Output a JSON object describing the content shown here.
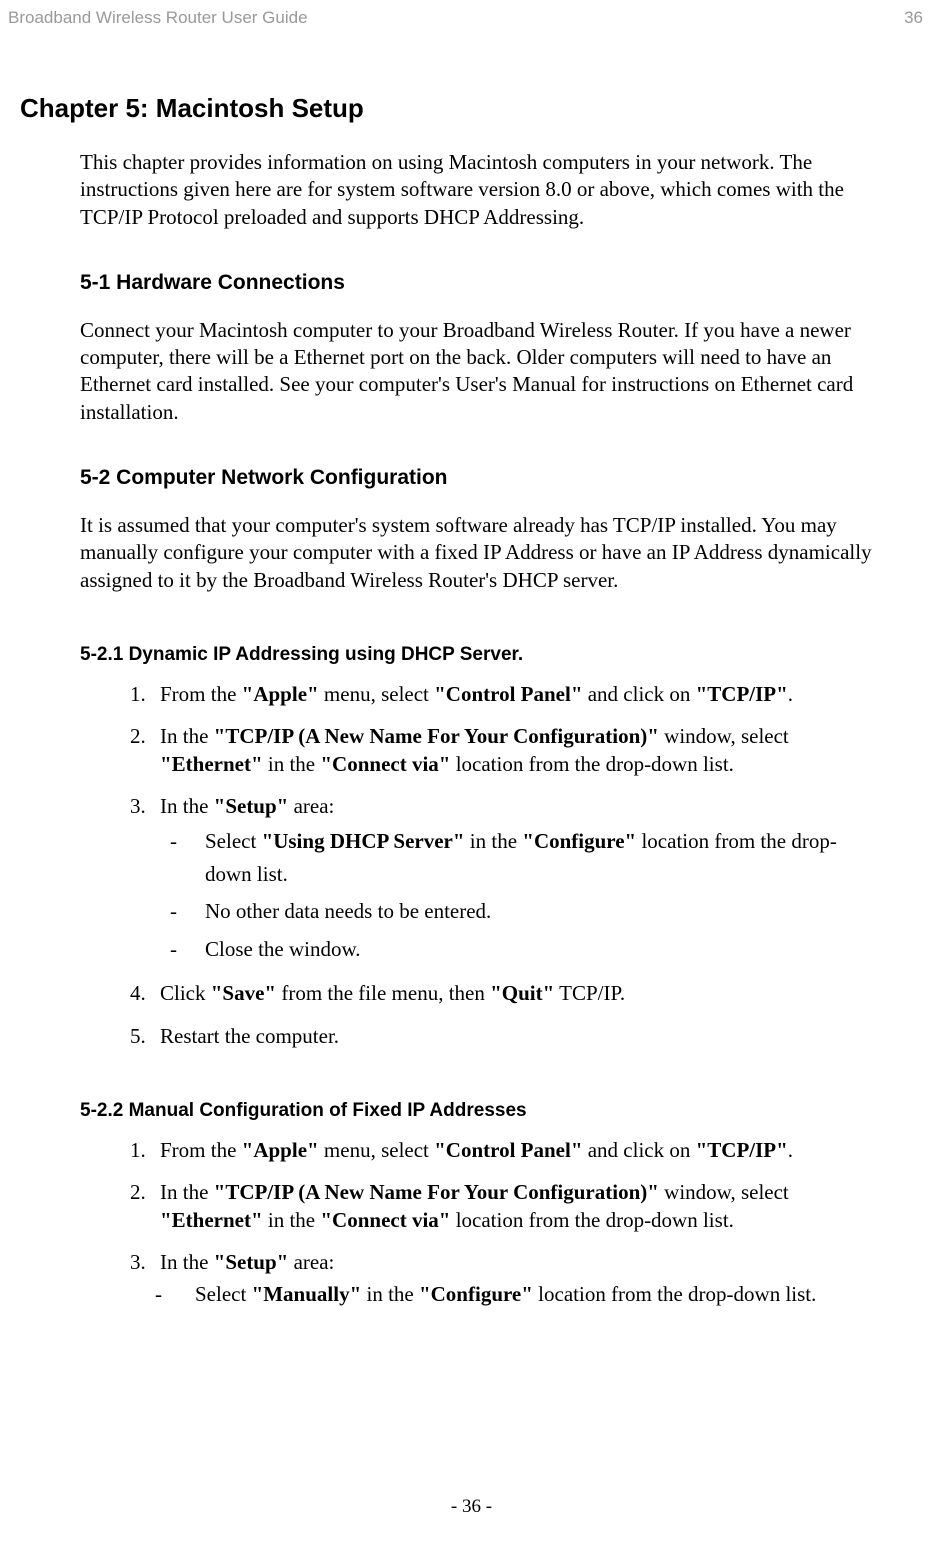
{
  "header": {
    "title": "Broadband Wireless Router User Guide",
    "page": "36"
  },
  "chapter": {
    "title": "Chapter 5: Macintosh Setup",
    "intro": "This chapter provides information on using Macintosh computers in your network. The instructions given here are for system software version 8.0 or above, which comes with the TCP/IP Protocol preloaded and supports DHCP Addressing."
  },
  "section51": {
    "title": "5-1 Hardware Connections",
    "body": "Connect your Macintosh computer to your Broadband Wireless Router. If you have a newer computer, there will be a Ethernet port on the back. Older computers will need to have an Ethernet card installed. See your computer's User's Manual for instructions on Ethernet card installation."
  },
  "section52": {
    "title": "5-2 Computer Network Configuration",
    "body": "It is assumed that your computer's system software already has TCP/IP installed. You may manually configure your computer with a fixed IP Address or have an IP Address dynamically assigned to it by the Broadband Wireless Router's DHCP server."
  },
  "section521": {
    "title": "5-2.1 Dynamic IP Addressing using DHCP Server.",
    "items": {
      "n1": "1.",
      "t1a": "From the ",
      "t1b": "\"Apple\"",
      "t1c": " menu, select ",
      "t1d": "\"Control Panel\"",
      "t1e": " and click on ",
      "t1f": "\"TCP/IP\"",
      "t1g": ".",
      "n2": "2.",
      "t2a": "In the ",
      "t2b": "\"TCP/IP (A New Name For Your Configuration)\"",
      "t2c": " window, select ",
      "t2d": "\"Ethernet\"",
      "t2e": " in the ",
      "t2f": "\"Connect via\"",
      "t2g": " location from the drop-down list.",
      "n3": "3.",
      "t3a": "In the ",
      "t3b": "\"Setup\"",
      "t3c": " area:",
      "s3_1a": "Select ",
      "s3_1b": "\"Using DHCP Server\"",
      "s3_1c": " in the ",
      "s3_1d": "\"Configure\"",
      "s3_1e": " location from the drop-down list.",
      "s3_2": "No other data needs to be entered.",
      "s3_3": "Close the window.",
      "n4": "4.",
      "t4a": "Click ",
      "t4b": "\"Save\"",
      "t4c": " from the file menu, then ",
      "t4d": "\"Quit\"",
      "t4e": " TCP/IP.",
      "n5": "5.",
      "t5": "Restart the computer."
    }
  },
  "section522": {
    "title": "5-2.2 Manual Configuration of Fixed IP Addresses",
    "items": {
      "n1": "1.",
      "t1a": "From the ",
      "t1b": "\"Apple\"",
      "t1c": " menu, select ",
      "t1d": "\"Control Panel\"",
      "t1e": " and click on ",
      "t1f": "\"TCP/IP\"",
      "t1g": ".",
      "n2": "2.",
      "t2a": "In the ",
      "t2b": "\"TCP/IP (A New Name For Your Configuration)\"",
      "t2c": " window, select ",
      "t2d": "\"Ethernet\"",
      "t2e": " in the ",
      "t2f": "\"Connect via\"",
      "t2g": " location from the drop-down list.",
      "n3": "3.",
      "t3a": "In the ",
      "t3b": "\"Setup\"",
      "t3c": " area:",
      "s3_1a": "Select ",
      "s3_1b": "\"Manually\"",
      "s3_1c": " in the ",
      "s3_1d": "\"Configure\"",
      "s3_1e": " location from the drop-down list."
    }
  },
  "dash": "-",
  "footer": "- 36 -"
}
